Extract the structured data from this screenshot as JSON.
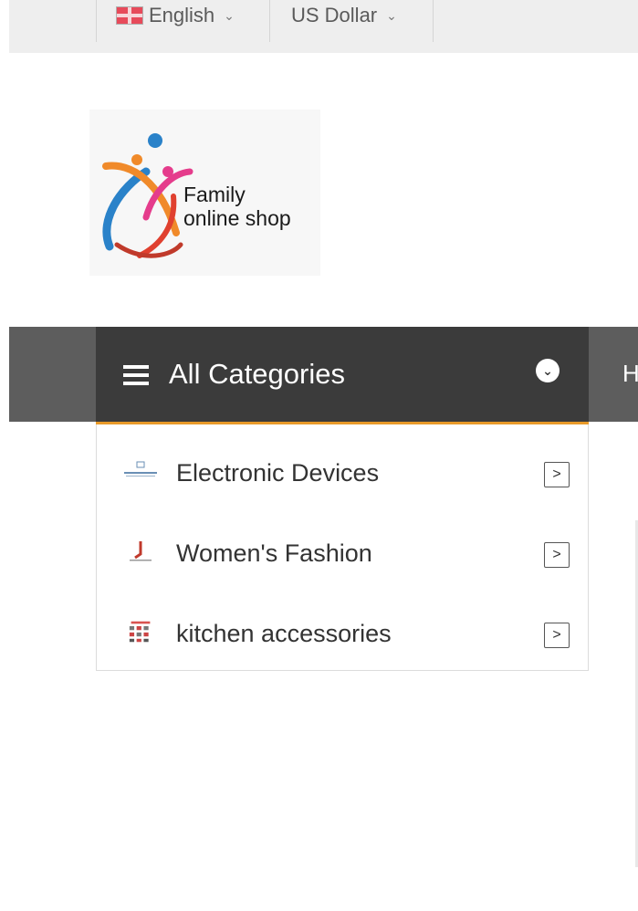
{
  "header": {
    "language": {
      "label": "English",
      "icon": "uk-flag-icon"
    },
    "currency": {
      "label": "US Dollar"
    }
  },
  "logo": {
    "line1": "Family",
    "line2": "online shop"
  },
  "nav": {
    "all_categories_label": "All Categories",
    "next_item_partial": "H"
  },
  "categories": [
    {
      "label": "Electronic Devices",
      "icon": "electronics-thumb-icon"
    },
    {
      "label": "Women's Fashion",
      "icon": "fashion-thumb-icon"
    },
    {
      "label": "kitchen accessories",
      "icon": "kitchen-thumb-icon"
    }
  ],
  "colors": {
    "nav_bg": "#5d5d5d",
    "category_header_bg": "#3b3b3b",
    "accent": "#e89a29",
    "topbar_bg": "#eeeeee"
  }
}
